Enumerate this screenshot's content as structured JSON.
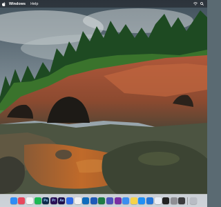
{
  "menubar": {
    "items": [
      {
        "label": "Windows",
        "bold": true
      },
      {
        "label": "Help",
        "bold": false
      }
    ]
  },
  "dock": {
    "apps": [
      {
        "name": "finder",
        "color": "#2f8df5",
        "glyph": ""
      },
      {
        "name": "launchpad",
        "color": "#e8475d",
        "glyph": ""
      },
      {
        "name": "chrome",
        "color": "#f4f4f4",
        "glyph": ""
      },
      {
        "name": "spotify",
        "color": "#1db954",
        "glyph": ""
      },
      {
        "name": "photoshop",
        "color": "#0c2a4a",
        "glyph": "Ps"
      },
      {
        "name": "premiere",
        "color": "#2a0f55",
        "glyph": "Pr"
      },
      {
        "name": "after-effects",
        "color": "#1d0f4a",
        "glyph": "Ae"
      },
      {
        "name": "fontbase",
        "color": "#2e6be6",
        "glyph": ""
      },
      {
        "name": "photos",
        "color": "#f0f0f0",
        "glyph": ""
      },
      {
        "name": "outlook",
        "color": "#0f6cbd",
        "glyph": ""
      },
      {
        "name": "word",
        "color": "#1e5ab8",
        "glyph": ""
      },
      {
        "name": "excel",
        "color": "#1d7a44",
        "glyph": ""
      },
      {
        "name": "teams",
        "color": "#4b53bc",
        "glyph": ""
      },
      {
        "name": "onenote",
        "color": "#7a2ea3",
        "glyph": ""
      },
      {
        "name": "mail",
        "color": "#3b8ef0",
        "glyph": ""
      },
      {
        "name": "notes",
        "color": "#f5d34a",
        "glyph": ""
      },
      {
        "name": "app-store",
        "color": "#1f8ff5",
        "glyph": ""
      },
      {
        "name": "xcode",
        "color": "#2376d8",
        "glyph": ""
      },
      {
        "name": "safari",
        "color": "#e9eef5",
        "glyph": ""
      },
      {
        "name": "terminal",
        "color": "#222222",
        "glyph": ""
      },
      {
        "name": "system-preferences",
        "color": "#8e8e93",
        "glyph": ""
      },
      {
        "name": "activity-monitor",
        "color": "#3a3a3c",
        "glyph": ""
      },
      {
        "name": "trash",
        "color": "#b8bcc4",
        "glyph": ""
      }
    ]
  }
}
